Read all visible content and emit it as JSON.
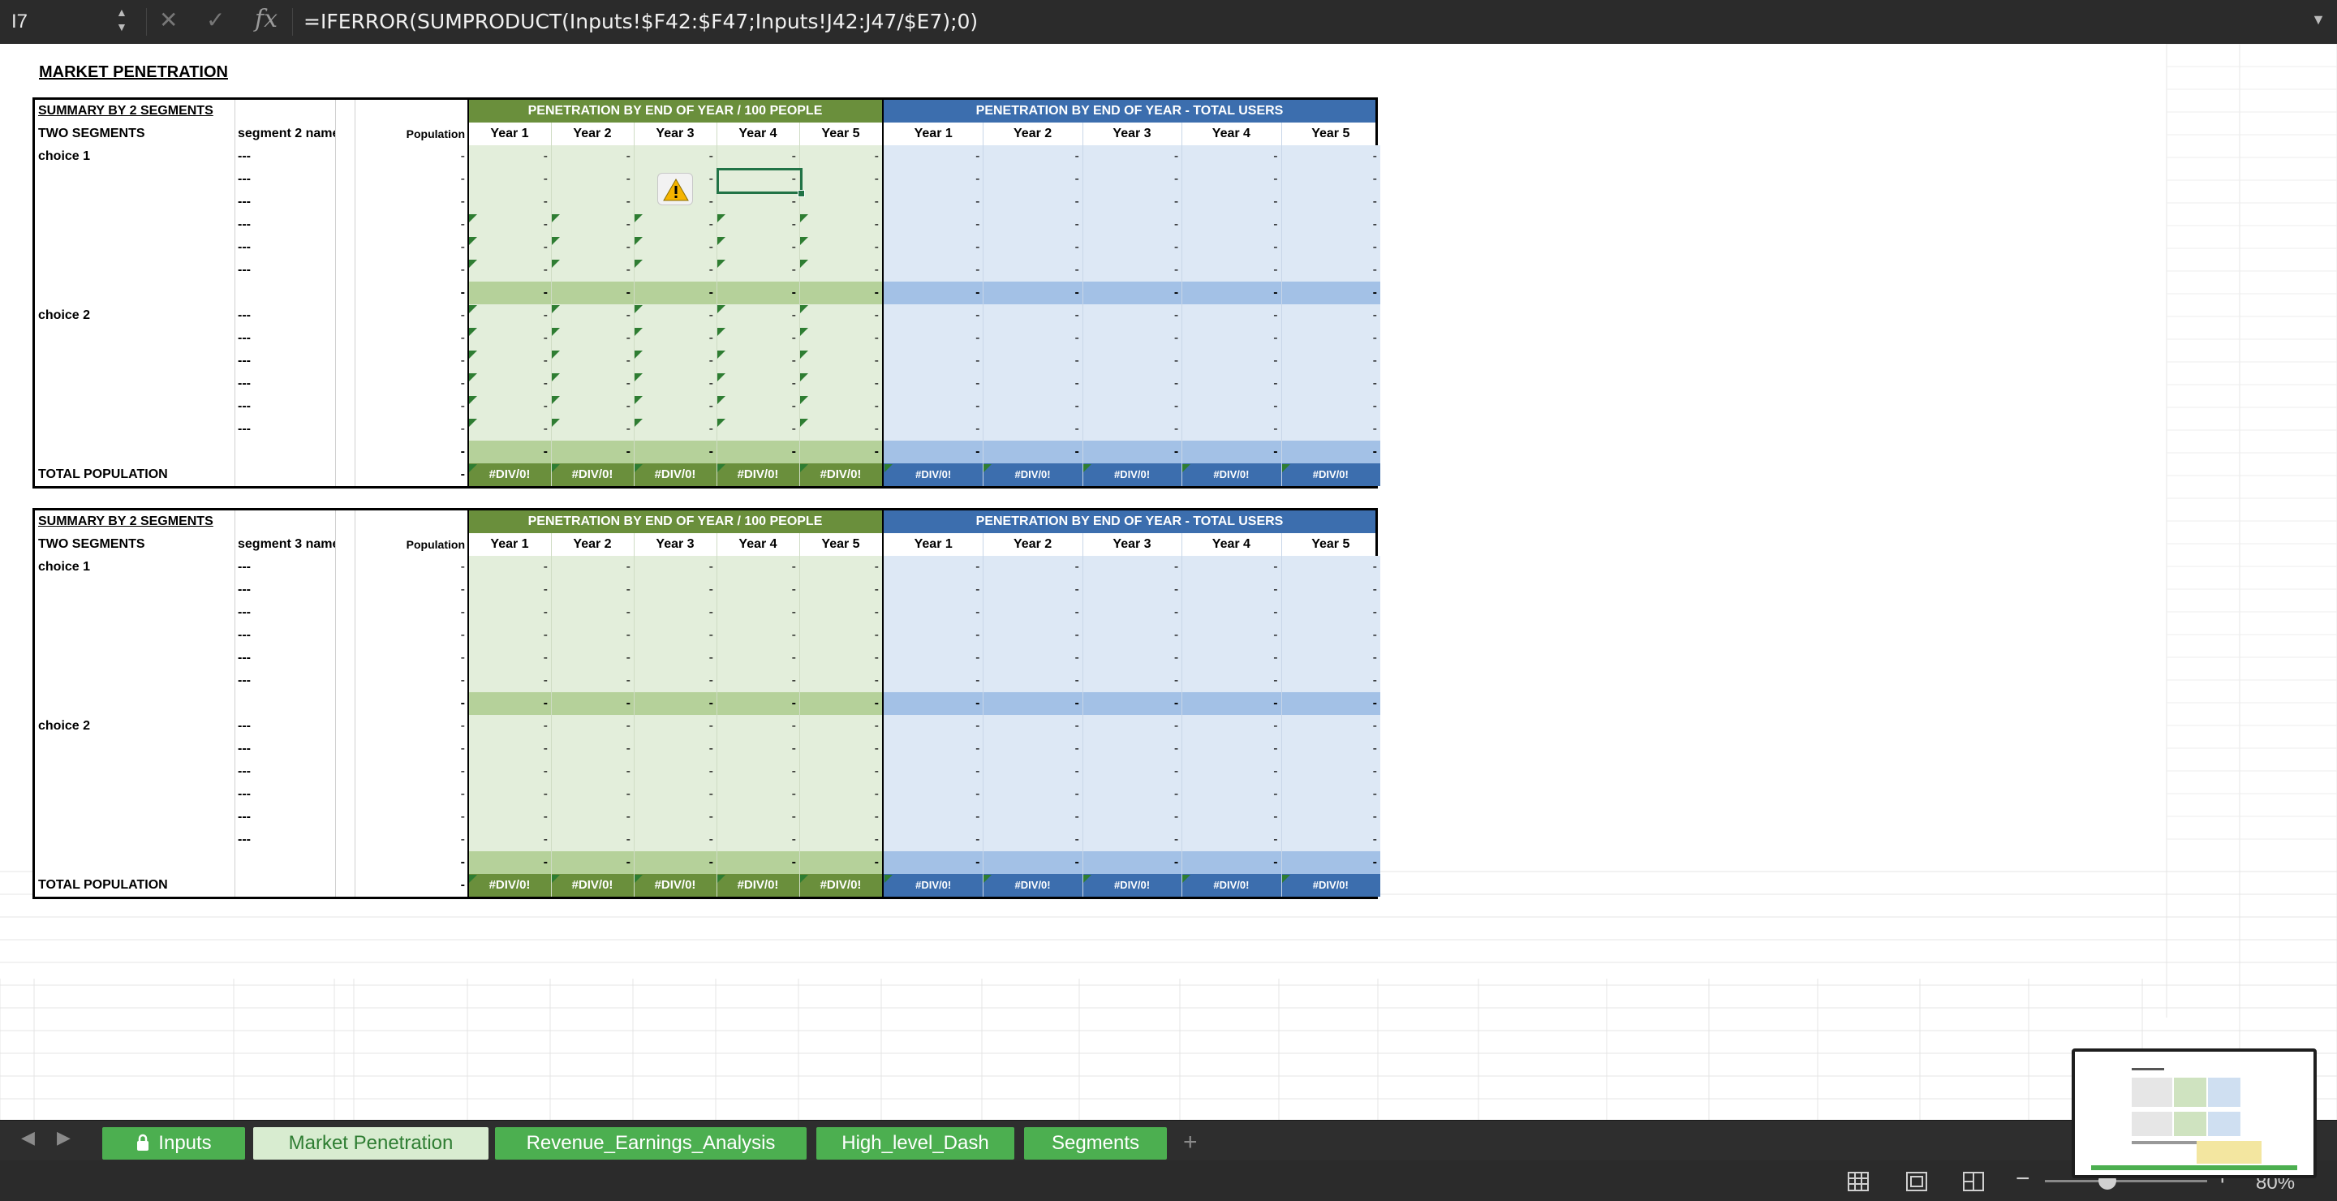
{
  "formula_bar": {
    "cell_ref": "I7",
    "formula": "=IFERROR(SUMPRODUCT(Inputs!$F42:$F47;Inputs!J42:J47/$E7);0)",
    "fx": "fx"
  },
  "page_title": "MARKET PENETRATION",
  "tables": [
    {
      "summary_title": "SUMMARY BY 2 SEGMENTS",
      "col_a_header": "TWO SEGMENTS",
      "col_b_header": "segment 2 name",
      "population_header": "Population",
      "group1_header": "PENETRATION BY END OF YEAR / 100 PEOPLE",
      "group2_header": "PENETRATION BY END OF YEAR - TOTAL USERS",
      "year_headers": [
        "Year 1",
        "Year 2",
        "Year 3",
        "Year 4",
        "Year 5"
      ],
      "choice1": "choice 1",
      "choice2": "choice 2",
      "segment_placeholder": "---",
      "dash": "-",
      "total_label": "TOTAL POPULATION",
      "div0": "#DIV/0!"
    },
    {
      "summary_title": "SUMMARY BY 2 SEGMENTS",
      "col_a_header": "TWO SEGMENTS",
      "col_b_header": "segment 3 name",
      "population_header": "Population",
      "group1_header": "PENETRATION BY END OF YEAR / 100 PEOPLE",
      "group2_header": "PENETRATION BY END OF YEAR - TOTAL USERS",
      "year_headers": [
        "Year 1",
        "Year 2",
        "Year 3",
        "Year 4",
        "Year 5"
      ],
      "choice1": "choice 1",
      "choice2": "choice 2",
      "segment_placeholder": "---",
      "dash": "-",
      "total_label": "TOTAL POPULATION",
      "div0": "#DIV/0!"
    }
  ],
  "sheet_tabs": [
    {
      "label": "Inputs",
      "locked": true,
      "active": false
    },
    {
      "label": "Market Penetration",
      "locked": false,
      "active": true
    },
    {
      "label": "Revenue_Earnings_Analysis",
      "locked": false,
      "active": false
    },
    {
      "label": "High_level_Dash",
      "locked": false,
      "active": false
    },
    {
      "label": "Segments",
      "locked": false,
      "active": false
    }
  ],
  "add_sheet": "+",
  "zoom": {
    "value": "80%",
    "percent": 80
  },
  "colors": {
    "green_header": "#6a8f3c",
    "green_light": "#e3eedb",
    "green_sub": "#b5d19a",
    "blue_header": "#3c6eae",
    "blue_light": "#dde8f5",
    "blue_sub": "#a3c1e6",
    "tab_green": "#4caf50"
  }
}
